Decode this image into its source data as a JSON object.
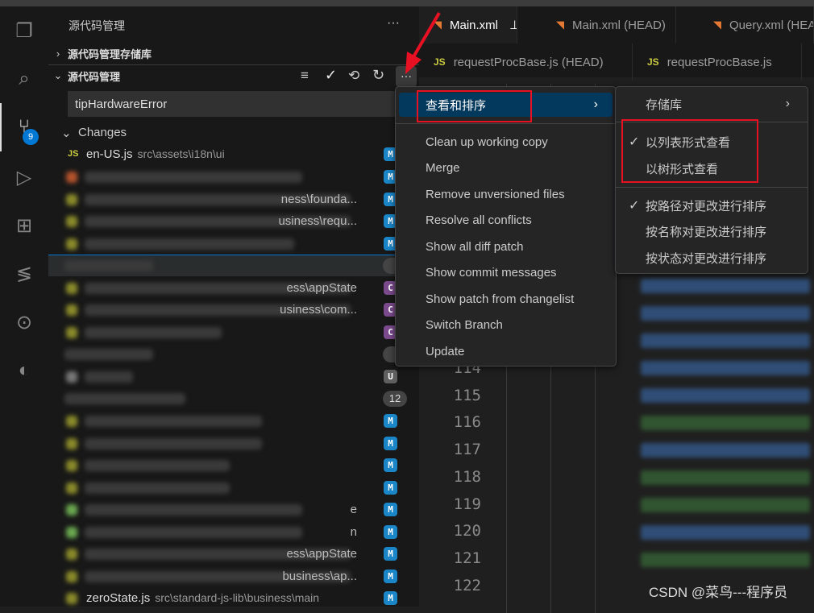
{
  "activity_bar": {
    "icons": [
      "files-icon",
      "search-icon",
      "source-control-icon",
      "run-debug-icon",
      "extensions-icon",
      "svn-icon",
      "git-graph-icon",
      "edge-icon"
    ],
    "scm_badge": "9"
  },
  "sidebar": {
    "title": "源代码管理",
    "more_label": "···",
    "repos_section": "源代码管理存储库",
    "scm_section": "源代码管理",
    "commit_message": "tipHardwareError",
    "changes_group": "Changes",
    "first_file": {
      "name": "en-US.js",
      "path": "src\\assets\\i18n\\ui",
      "badge": "M"
    },
    "partial_tails": [
      "ness\\founda...",
      "usiness\\requ...",
      "ess\\appState",
      "usiness\\com...",
      "e",
      "n",
      "ess\\appState",
      "business\\ap..."
    ],
    "remote_count": "12",
    "last_file": {
      "name": "zeroState.js",
      "path": "src\\standard-js-lib\\business\\main",
      "badge": "M"
    },
    "badges": {
      "modified": "M",
      "conflict": "C",
      "unversioned": "U"
    },
    "colors": {
      "modified": "#1a85c7",
      "conflict": "#7a4a8c",
      "unversioned": "#5f5f5f"
    }
  },
  "tabs": {
    "row1": [
      {
        "label": "Main.xml",
        "pinned": true,
        "active": true
      },
      {
        "label": "Main.xml (HEAD)"
      },
      {
        "label": "Query.xml (HEAD)"
      }
    ],
    "row2": [
      {
        "label": "requestProcBase.js (HEAD)"
      },
      {
        "label": "requestProcBase.js"
      }
    ]
  },
  "editor": {
    "line_numbers": [
      "114",
      "115",
      "116",
      "117",
      "118",
      "119",
      "120",
      "121",
      "122"
    ]
  },
  "context_menu": {
    "items": [
      "查看和排序",
      "Clean up working copy",
      "Merge",
      "Remove unversioned files",
      "Resolve all conflicts",
      "Show all diff patch",
      "Show commit messages",
      "Show patch from changelist",
      "Switch Branch",
      "Update"
    ]
  },
  "submenu": {
    "repositories": "存储库",
    "view_list": "以列表形式查看",
    "view_tree": "以树形式查看",
    "sort_path": "按路径对更改进行排序",
    "sort_name": "按名称对更改进行排序",
    "sort_status": "按状态对更改进行排序",
    "checked": [
      "以列表形式查看",
      "按路径对更改进行排序"
    ]
  },
  "watermark": "CSDN @菜鸟---程序员"
}
